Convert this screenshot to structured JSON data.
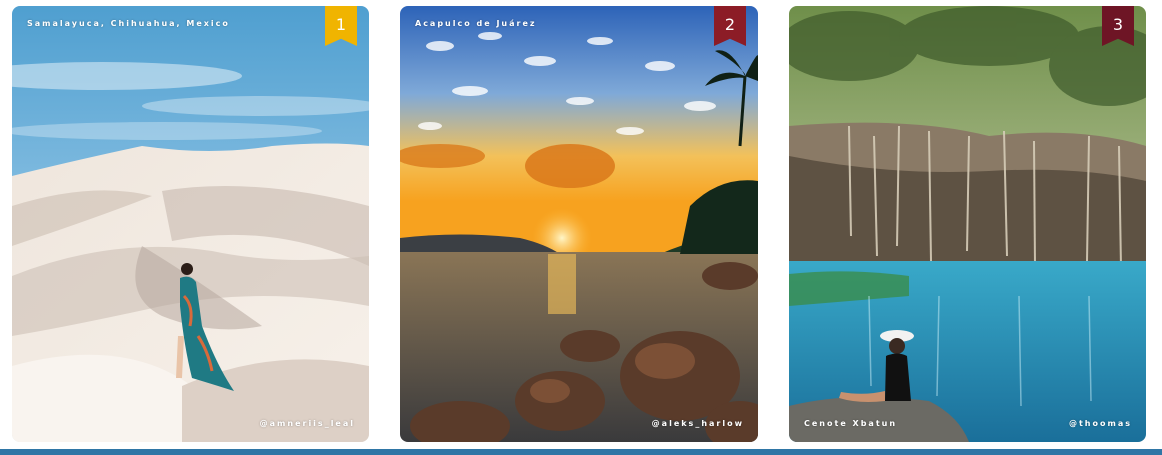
{
  "cards": [
    {
      "rank": "1",
      "location": "Samalayuca, Chihuahua, Mexico",
      "credit": "@amneriis_leal",
      "ribbon_color": "#f0b400",
      "photo": "white sand dunes under blue sky with woman in teal floral dress"
    },
    {
      "rank": "2",
      "location": "Acapulco de Juárez",
      "credit": "@aleks_harlow",
      "ribbon_color": "#8c1c26",
      "photo": "sunset over bay with clouds, palm trees and rocky shore"
    },
    {
      "rank": "3",
      "location": "Cenote Xbatun",
      "credit": "@thoomas",
      "ribbon_color": "#6e1525",
      "photo": "turquoise cenote with hanging roots and woman in hat sitting on rock"
    }
  ],
  "accent_bar_color": "#2f76a6"
}
